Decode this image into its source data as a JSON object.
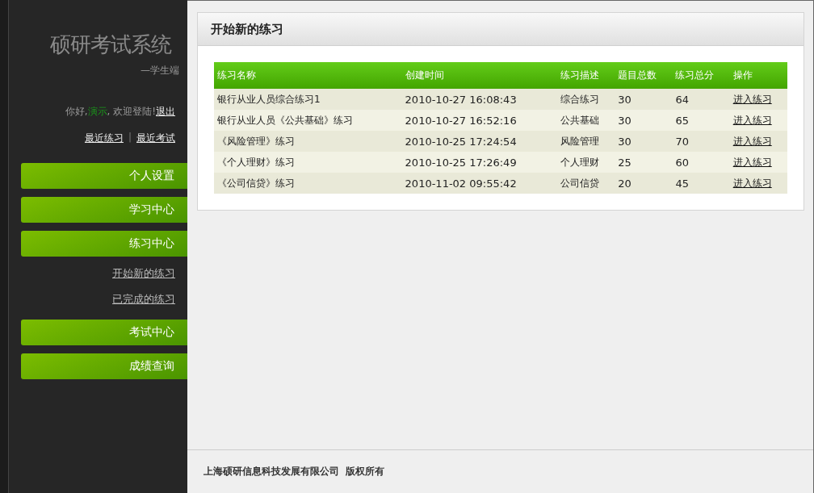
{
  "sidebar": {
    "title": "硕研考试系统",
    "subtitle": "—学生端",
    "greeting": {
      "prefix": "你好,",
      "user": "演示",
      "suffix": ", 欢迎登陆!",
      "logout": "退出"
    },
    "quick_links": [
      "最近练习",
      "最近考试"
    ],
    "quick_separator": "|",
    "menu": [
      {
        "label": "个人设置"
      },
      {
        "label": "学习中心"
      },
      {
        "label": "练习中心",
        "children": [
          {
            "label": "开始新的练习"
          },
          {
            "label": "已完成的练习"
          }
        ]
      },
      {
        "label": "考试中心"
      },
      {
        "label": "成绩查询"
      }
    ]
  },
  "panel": {
    "title": "开始新的练习",
    "table": {
      "columns": [
        "练习名称",
        "创建时间",
        "练习描述",
        "题目总数",
        "练习总分",
        "操作"
      ],
      "rows": [
        [
          "银行从业人员综合练习1",
          "2010-10-27 16:08:43",
          "综合练习",
          "30",
          "64",
          "进入练习"
        ],
        [
          "银行从业人员《公共基础》练习",
          "2010-10-27 16:52:16",
          "公共基础",
          "30",
          "65",
          "进入练习"
        ],
        [
          "《风险管理》练习",
          "2010-10-25 17:24:54",
          "风险管理",
          "30",
          "70",
          "进入练习"
        ],
        [
          "《个人理财》练习",
          "2010-10-25 17:26:49",
          "个人理财",
          "25",
          "60",
          "进入练习"
        ],
        [
          "《公司信贷》练习",
          "2010-11-02 09:55:42",
          "公司信贷",
          "20",
          "45",
          "进入练习"
        ]
      ]
    }
  },
  "footer": {
    "company": "上海硕研信息科技发展有限公司",
    "rights": "版权所有"
  }
}
